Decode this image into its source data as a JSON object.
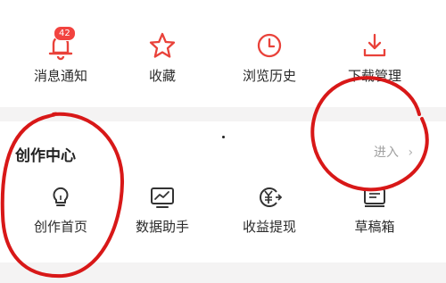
{
  "top_menu": {
    "items": [
      {
        "label": "消息通知",
        "icon": "bell-icon",
        "badge": "42"
      },
      {
        "label": "收藏",
        "icon": "star-icon"
      },
      {
        "label": "浏览历史",
        "icon": "clock-icon"
      },
      {
        "label": "下载管理",
        "icon": "download-icon"
      }
    ]
  },
  "creator_center": {
    "title": "创作中心",
    "enter_label": "进入",
    "items": [
      {
        "label": "创作首页",
        "icon": "lightbulb-icon"
      },
      {
        "label": "数据助手",
        "icon": "chart-monitor-icon"
      },
      {
        "label": "收益提现",
        "icon": "yuan-coin-icon"
      },
      {
        "label": "草稿箱",
        "icon": "draft-box-icon"
      }
    ]
  },
  "colors": {
    "accent": "#e9423a",
    "icon_dark": "#333333",
    "annotation_red": "#d81818",
    "badge": "#f2433f",
    "background": "#f4f3f3"
  }
}
